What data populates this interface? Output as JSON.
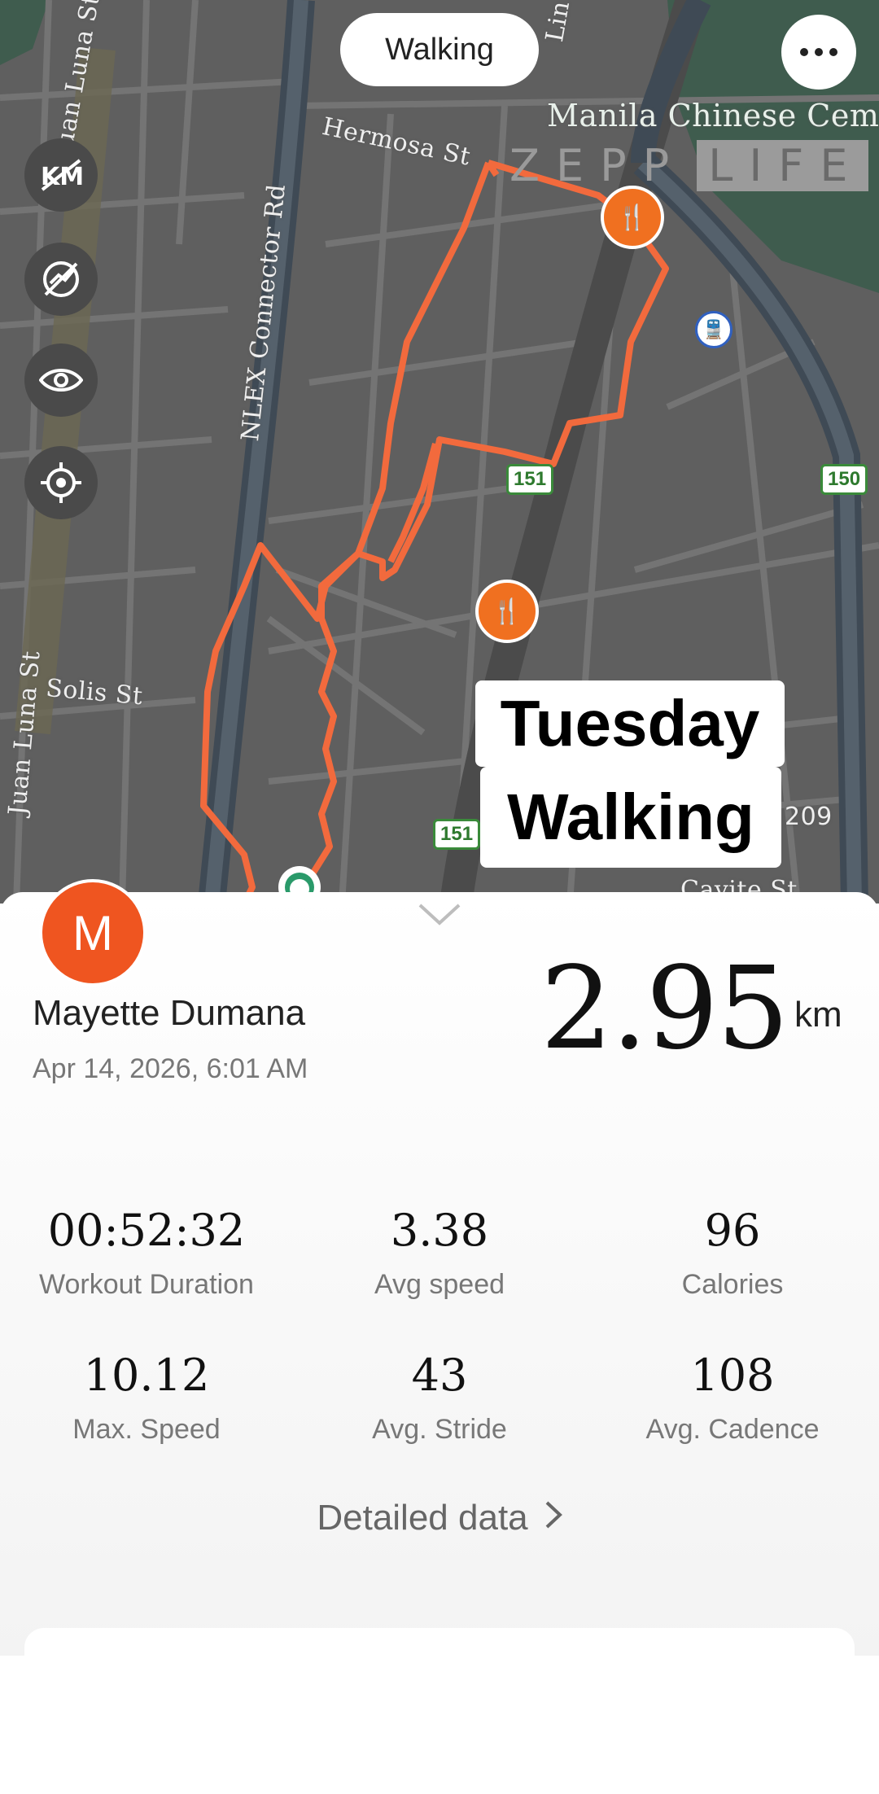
{
  "map": {
    "activity_label": "Walking",
    "streets": {
      "juan_luna_1": "Juan Luna St",
      "juan_luna_2": "Juan Luna St",
      "nlex": "NLEX Connector Rd",
      "hermosa": "Hermosa St",
      "solis": "Solis St",
      "cemetery": "Manila Chinese Cem",
      "cavite": "Cavite St",
      "lin": "Lin"
    },
    "route_shields": [
      "151",
      "150",
      "151",
      "209"
    ],
    "brand": {
      "zepp": "ZEPP",
      "life": "LIFE"
    },
    "controls": [
      "kilometer-marker-toggle-icon",
      "speed-toggle-icon",
      "visibility-icon",
      "locate-icon"
    ],
    "route_color": "#f26a3d",
    "poi_color": "#f07020"
  },
  "overlay": {
    "line1": "Tuesday",
    "line2": "Walking"
  },
  "user": {
    "avatar_letter": "M",
    "name": "Mayette Dumana",
    "date": "Apr 14, 2026, 6:01 AM",
    "avatar_color": "#ef5520"
  },
  "summary": {
    "distance": "2.95",
    "unit": "km"
  },
  "stats": [
    {
      "value": "00:52:32",
      "label": "Workout Duration"
    },
    {
      "value": "3.38",
      "label": "Avg speed"
    },
    {
      "value": "96",
      "label": "Calories"
    },
    {
      "value": "10.12",
      "label": "Max. Speed"
    },
    {
      "value": "43",
      "label": "Avg. Stride"
    },
    {
      "value": "108",
      "label": "Avg. Cadence"
    }
  ],
  "detail_link": "Detailed data"
}
